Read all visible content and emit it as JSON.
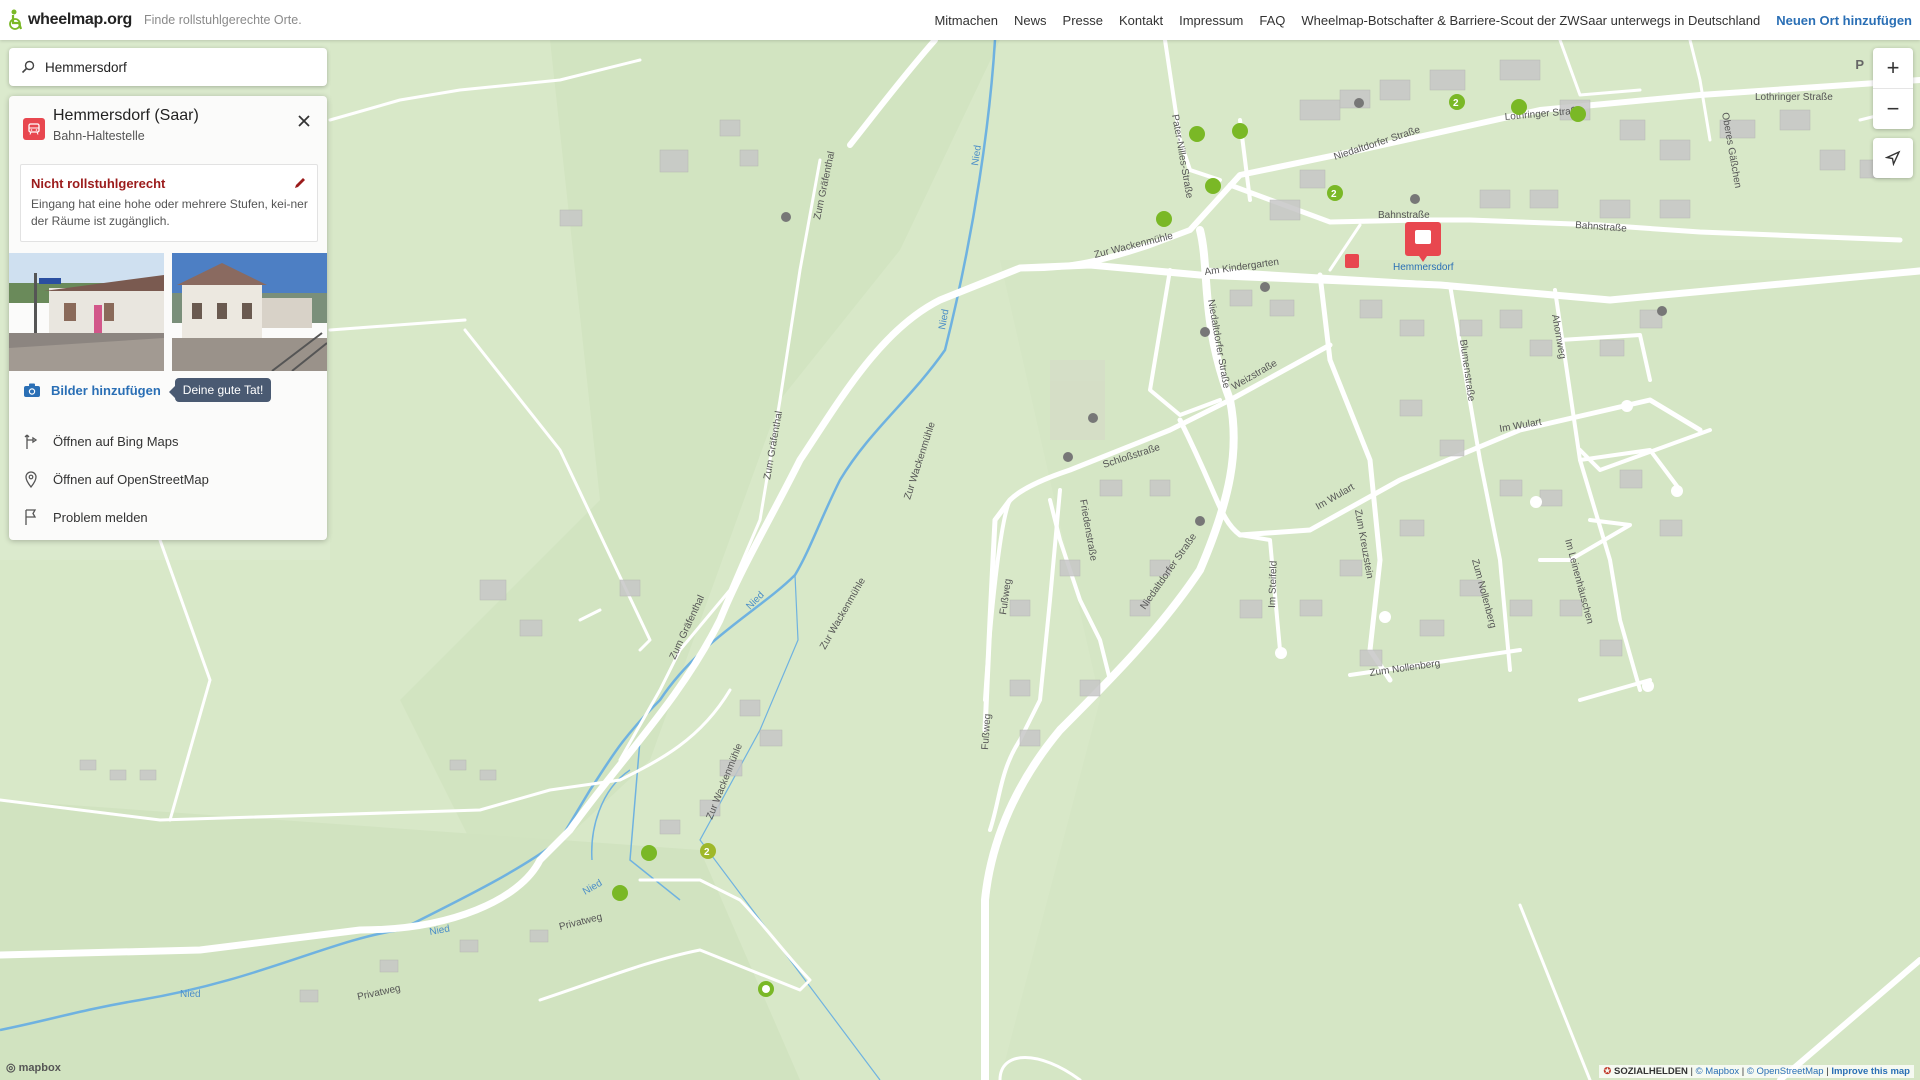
{
  "topbar": {
    "logo": "wheelmap.org",
    "claim": "Finde rollstuhlgerechte Orte.",
    "nav": [
      "Mitmachen",
      "News",
      "Presse",
      "Kontakt",
      "Impressum",
      "FAQ",
      "Wheelmap-Botschafter & Barriere-Scout der ZWSaar unterwegs in Deutschland"
    ],
    "add_place": "Neuen Ort hinzufügen"
  },
  "search": {
    "value": "Hemmersdorf"
  },
  "place": {
    "name": "Hemmersdorf (Saar)",
    "category": "Bahn-Haltestelle",
    "accessibility_title": "Nicht rollstuhlgerecht",
    "accessibility_desc": "Eingang hat eine hohe oder mehrere Stufen, kei-ner der Räume ist zugänglich.",
    "add_photos": "Bilder hinzufügen",
    "tip": "Deine gute Tat!",
    "links": [
      "Öffnen auf Bing Maps",
      "Öffnen auf OpenStreetMap",
      "Problem melden"
    ]
  },
  "map": {
    "marker_label": "Hemmersdorf",
    "streets": [
      "Zur Wackenmühle",
      "Zum Gräfenthal",
      "Nied",
      "Privatweg",
      "Niedaltdorfer Straße",
      "Bahnstraße",
      "Am Kindergarten",
      "Weizstraße",
      "Schloßstraße",
      "Friedenstraße",
      "Fußweg",
      "Im Wulart",
      "Im Steifeld",
      "Zum Kreuzstein",
      "Zum Nollenberg",
      "Blumenstraße",
      "Ahornweg",
      "Im Leinenhäuschen",
      "Lothringer Straße",
      "Pater-Nilles-Straße",
      "Oberes Gäßchen"
    ],
    "zoom_in": "+",
    "zoom_out": "−",
    "p_label": "P"
  },
  "attribution": {
    "sozialhelden": "SOZIALHELDEN",
    "mapbox": "© Mapbox",
    "osm": "© OpenStreetMap",
    "improve": "Improve this map",
    "mapbox_logo": "mapbox"
  },
  "colors": {
    "accent": "#2a6fb5",
    "alert": "#9b1b1b",
    "marker": "#e8474f",
    "green_poi": "#7ab826"
  }
}
